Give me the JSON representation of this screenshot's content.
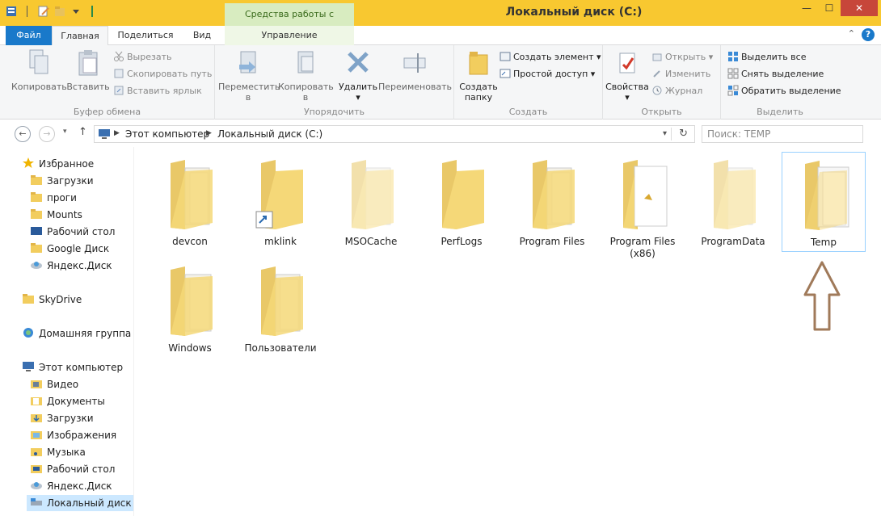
{
  "window": {
    "title": "Локальный диск (C:)",
    "context_tab_title": "Средства работы с дисками",
    "minimize": "—",
    "maximize": "☐",
    "close": "✕"
  },
  "tabs": {
    "file": "Файл",
    "home": "Главная",
    "share": "Поделиться",
    "view": "Вид",
    "manage": "Управление",
    "help": "?",
    "collapse": "⌃"
  },
  "ribbon": {
    "clipboard": {
      "label": "Буфер обмена",
      "copy": "Копировать",
      "paste": "Вставить",
      "cut": "Вырезать",
      "copy_path": "Скопировать путь",
      "paste_shortcut": "Вставить ярлык"
    },
    "organize": {
      "label": "Упорядочить",
      "move_line1": "Переместить",
      "move_line2": "в",
      "copy_line1": "Копировать",
      "copy_line2": "в",
      "delete": "Удалить",
      "rename": "Переименовать"
    },
    "create": {
      "label": "Создать",
      "new_folder_line1": "Создать",
      "new_folder_line2": "папку",
      "new_item": "Создать элемент",
      "easy_access": "Простой доступ"
    },
    "open": {
      "label": "Открыть",
      "properties": "Свойства",
      "open": "Открыть",
      "edit": "Изменить",
      "history": "Журнал"
    },
    "select": {
      "label": "Выделить",
      "select_all": "Выделить все",
      "select_none": "Снять выделение",
      "invert": "Обратить выделение"
    }
  },
  "address": {
    "back": "←",
    "forward": "→",
    "up": "↑",
    "segments": [
      "Этот компьютер",
      "Локальный диск (C:)"
    ],
    "search_placeholder": "Поиск: TEMP"
  },
  "navpane": {
    "favorites": "Избранное",
    "fav_items": [
      "Загрузки",
      "проги",
      "Mounts",
      "Рабочий стол",
      "Google Диск",
      "Яндекс.Диск"
    ],
    "skydrive": "SkyDrive",
    "homegroup": "Домашняя группа",
    "computer": "Этот компьютер",
    "comp_items": [
      "Видео",
      "Документы",
      "Загрузки",
      "Изображения",
      "Музыка",
      "Рабочий стол",
      "Яндекс.Диск",
      "Локальный диск (C"
    ]
  },
  "folders": [
    {
      "name": "devcon",
      "kind": "docs"
    },
    {
      "name": "mklink",
      "kind": "shortcut"
    },
    {
      "name": "MSOCache",
      "kind": "faded"
    },
    {
      "name": "PerfLogs",
      "kind": "empty"
    },
    {
      "name": "Program Files",
      "kind": "docs"
    },
    {
      "name": "Program Files (x86)",
      "kind": "paper"
    },
    {
      "name": "ProgramData",
      "kind": "faded"
    },
    {
      "name": "Temp",
      "kind": "paper-white",
      "selected": true
    },
    {
      "name": "Windows",
      "kind": "docs"
    },
    {
      "name": "Пользователи",
      "kind": "docs"
    }
  ],
  "colors": {
    "titlebar": "#f8c830",
    "file_tab": "#1979ca",
    "selection": "#cce8ff",
    "annotation_arrow": "#a07a5a"
  }
}
